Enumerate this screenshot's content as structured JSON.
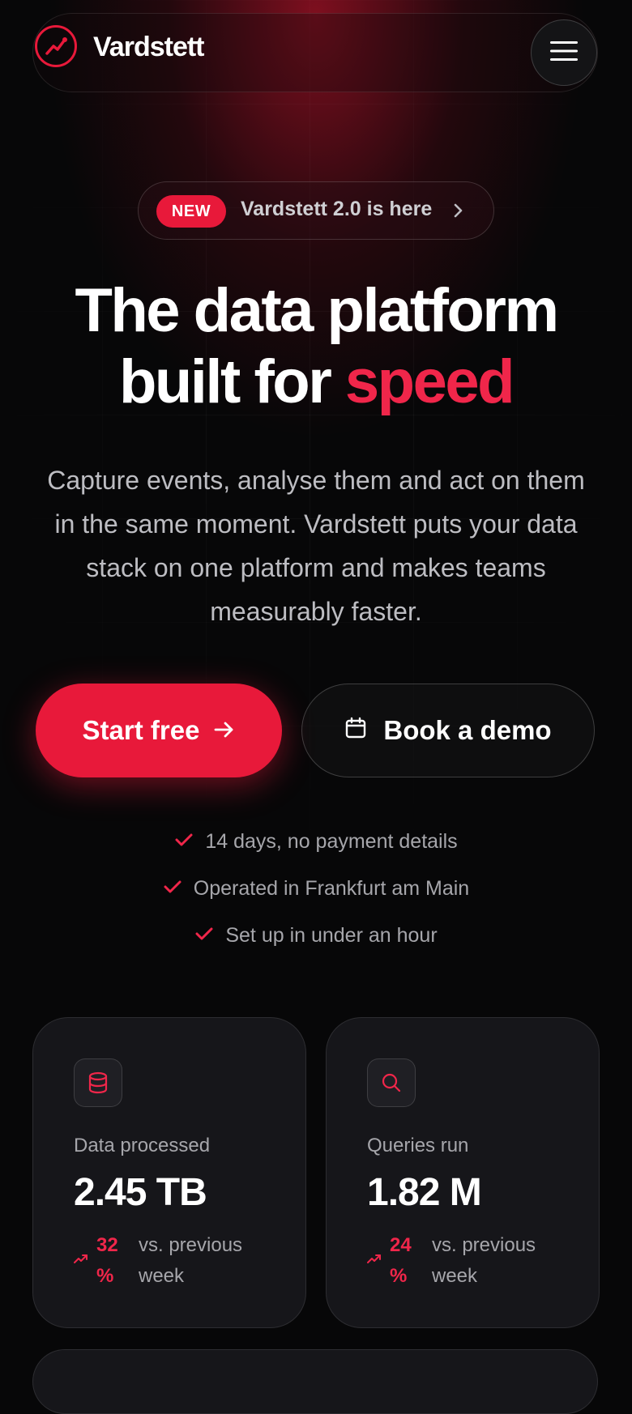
{
  "nav": {
    "brand": "Vardstett",
    "logo_icon": "trend-line-icon",
    "menu_icon": "hamburger-menu-icon"
  },
  "announcement": {
    "badge": "NEW",
    "text": "Vardstett 2.0 is here",
    "icon": "chevron-right-icon"
  },
  "hero": {
    "headline_line1": "The data platform",
    "headline_line2_prefix": "built for ",
    "headline_accent": "speed",
    "lede": "Capture events, analyse them and act on them in the same moment. Vardstett puts your data stack on one platform and makes teams measurably faster."
  },
  "cta": {
    "primary_label": "Start free",
    "primary_icon": "arrow-right-icon",
    "secondary_label": "Book a demo",
    "secondary_icon": "calendar-icon"
  },
  "checks": [
    {
      "text": "14 days, no payment details"
    },
    {
      "text": "Operated in Frankfurt am Main"
    },
    {
      "text": "Set up in under an hour"
    }
  ],
  "stats": [
    {
      "icon": "database-icon",
      "label": "Data processed",
      "value": "2.45 TB",
      "change": "32 %",
      "note": "vs. previous week"
    },
    {
      "icon": "search-icon",
      "label": "Queries run",
      "value": "1.82 M",
      "change": "24 %",
      "note": "vs. previous week"
    }
  ],
  "colors": {
    "accent": "#e8193a",
    "accent_text": "#f0264a",
    "background": "#070708",
    "card": "#16161a"
  }
}
